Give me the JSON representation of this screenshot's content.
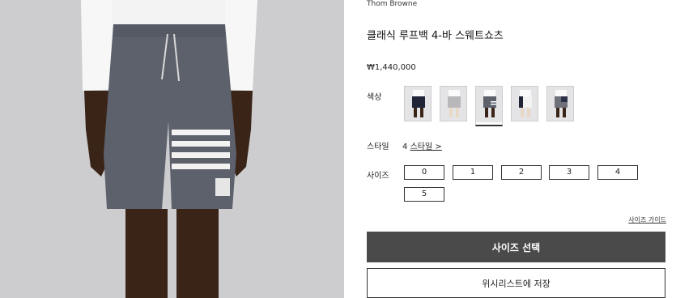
{
  "product": {
    "brand": "Thom Browne",
    "title": "클래식 루프백 4-바 스웨트쇼츠",
    "price": "₩1,440,000"
  },
  "color": {
    "label": "색상",
    "swatches": [
      {
        "name": "navy",
        "selected": false
      },
      {
        "name": "light-grey",
        "selected": false
      },
      {
        "name": "medium-grey",
        "selected": true
      },
      {
        "name": "white",
        "selected": false
      },
      {
        "name": "grey-colorblock",
        "selected": false
      }
    ]
  },
  "style": {
    "label": "스타일",
    "count": "4",
    "link_text": "스타일 >"
  },
  "size": {
    "label": "사이즈",
    "options": [
      "0",
      "1",
      "2",
      "3",
      "4",
      "5"
    ],
    "guide": "사이즈 가이드"
  },
  "actions": {
    "select_size": "사이즈 선택",
    "wishlist": "위시리스트에 저장"
  },
  "colors": {
    "primary_button": "#4a4a4a",
    "short_fabric": "#5b5f6a",
    "background_photo": "#d0d0d3"
  }
}
